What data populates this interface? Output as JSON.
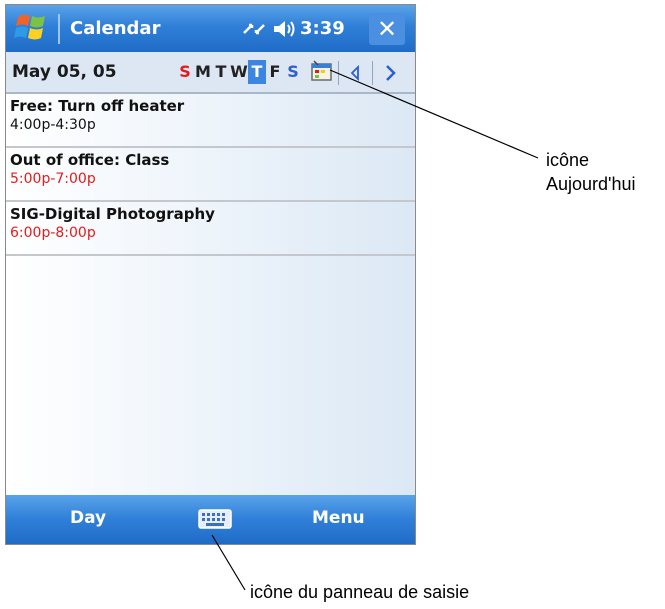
{
  "titlebar": {
    "title": "Calendar",
    "clock": "3:39",
    "close_label": "✕"
  },
  "datebar": {
    "date": "May 05, 05",
    "days": [
      {
        "label": "S",
        "kind": "sun"
      },
      {
        "label": "M",
        "kind": "normal"
      },
      {
        "label": "T",
        "kind": "normal"
      },
      {
        "label": "W",
        "kind": "normal"
      },
      {
        "label": "T",
        "kind": "selected"
      },
      {
        "label": "F",
        "kind": "normal"
      },
      {
        "label": "S",
        "kind": "sat"
      }
    ]
  },
  "appointments": [
    {
      "title": "Free: Turn off heater",
      "time": "4:00p-4:30p",
      "time_color": "black"
    },
    {
      "title": "Out of office: Class",
      "time": "5:00p-7:00p",
      "time_color": "red"
    },
    {
      "title": "SIG-Digital Photography",
      "time": "6:00p-8:00p",
      "time_color": "red"
    }
  ],
  "menubar": {
    "left_label": "Day",
    "right_label": "Menu"
  },
  "callouts": {
    "today_icon": "icône\nAujourd'hui",
    "input_panel": "icône du panneau de saisie"
  },
  "icons": [
    "windows-start-icon",
    "connectivity-icon",
    "volume-icon",
    "today-icon",
    "prev-arrow-icon",
    "next-arrow-icon",
    "keyboard-icon"
  ],
  "colors": {
    "titlebar": "#2f7fd8",
    "accent_red": "#e41b1b",
    "selected_day": "#3a86e0"
  }
}
